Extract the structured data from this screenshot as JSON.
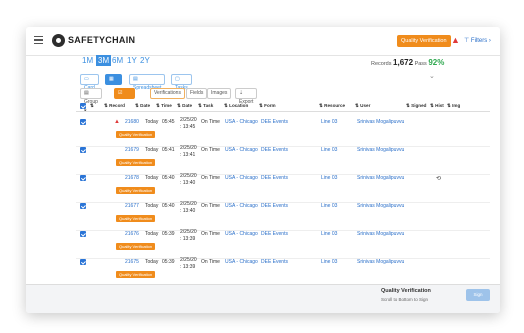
{
  "header": {
    "logo_text": "SAFETYCHAIN",
    "quality_verification": "Quality Verification",
    "warn_glyph": "▲",
    "filters_label": "Filters",
    "filters_icon": "⊤",
    "filters_chevron": "›"
  },
  "time_range": {
    "tabs": [
      "1M",
      "3M",
      "6M",
      "1Y",
      "2Y"
    ],
    "active": "3M"
  },
  "stats": {
    "records_label": "Records",
    "records_value": "1,672",
    "pass_label": "Pass",
    "pass_value": "92%"
  },
  "views": {
    "tabs": [
      "Card",
      "Grid",
      "Spreadsheet",
      "Tasks"
    ],
    "active": "Grid",
    "icons": [
      "card-icon",
      "grid-icon",
      "spreadsheet-icon",
      "tasks-icon"
    ],
    "glyphs": [
      "▭",
      "▦",
      "▤",
      "▢"
    ]
  },
  "toolbar": {
    "group": "Group",
    "group_icon": "▤",
    "verify": "Verify",
    "verify_icon": "☑",
    "dropdown_glyph": "▾",
    "verifications": "Verifications",
    "fields": "Fields",
    "images": "Images",
    "export": "Export",
    "export_icon": "⇣"
  },
  "table": {
    "columns": [
      "Record",
      "Date",
      "Time",
      "Date",
      "Task",
      "Location",
      "Form",
      "Resource",
      "User",
      "Signed",
      "Hist",
      "Img"
    ],
    "column_glyph": "⇅",
    "rows": [
      {
        "record": "21680",
        "date": "Today",
        "time": "05:45",
        "date2_top": "2/25/20",
        "date2_bot": ": 13:45",
        "task": "On Time",
        "location": "USA - Chicago",
        "form": "DEE Events",
        "resource": "Line 03",
        "user": "Srinivas Mogalipuvvu",
        "warn": true,
        "undo": false
      },
      {
        "record": "21679",
        "date": "Today",
        "time": "05:41",
        "date2_top": "2/25/20",
        "date2_bot": ": 13:41",
        "task": "On Time",
        "location": "USA - Chicago",
        "form": "DEE Events",
        "resource": "Line 03",
        "user": "Srinivas Mogalipuvvu",
        "warn": false,
        "undo": false
      },
      {
        "record": "21678",
        "date": "Today",
        "time": "05:40",
        "date2_top": "2/25/20",
        "date2_bot": ": 13:40",
        "task": "On Time",
        "location": "USA - Chicago",
        "form": "DEE Events",
        "resource": "Line 03",
        "user": "Srinivas Mogalipuvvu",
        "warn": false,
        "undo": true
      },
      {
        "record": "21677",
        "date": "Today",
        "time": "05:40",
        "date2_top": "2/25/20",
        "date2_bot": ": 13:40",
        "task": "On Time",
        "location": "USA - Chicago",
        "form": "DEE Events",
        "resource": "Line 03",
        "user": "Srinivas Mogalipuvvu",
        "warn": false,
        "undo": false
      },
      {
        "record": "21676",
        "date": "Today",
        "time": "05:39",
        "date2_top": "2/25/20",
        "date2_bot": ": 13:39",
        "task": "On Time",
        "location": "USA - Chicago",
        "form": "DEE Events",
        "resource": "Line 03",
        "user": "Srinivas Mogalipuvvu",
        "warn": false,
        "undo": false
      },
      {
        "record": "21675",
        "date": "Today",
        "time": "05:39",
        "date2_top": "2/25/20",
        "date2_bot": ": 13:39",
        "task": "On Time",
        "location": "USA - Chicago",
        "form": "DEE Events",
        "resource": "Line 03",
        "user": "Srinivas Mogalipuvvu",
        "warn": false,
        "undo": false
      }
    ],
    "qv_pill": "Quality Verification",
    "warn_glyph": "▲",
    "undo_glyph": "⟲"
  },
  "footer": {
    "title": "Quality Verification",
    "subtitle": "Scroll to Bottom to Sign",
    "sign_button": "Sign"
  },
  "colors": {
    "accent": "#3b8fe0",
    "orange": "#f08c1c",
    "pass_green": "#2fa84f",
    "warning_red": "#e03a3a"
  }
}
